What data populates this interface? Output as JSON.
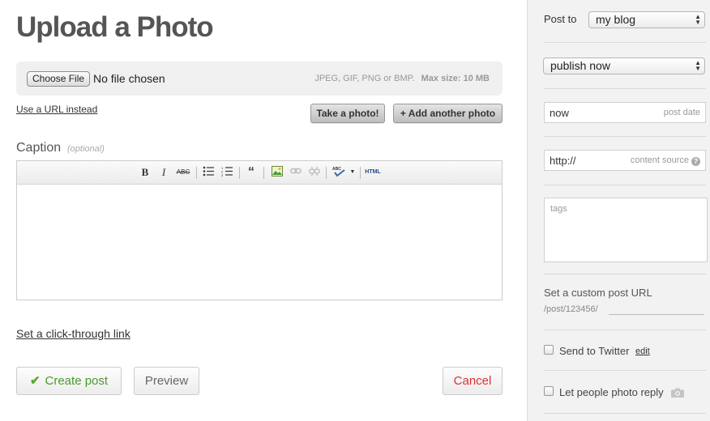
{
  "main": {
    "title": "Upload a Photo",
    "file": {
      "choose_label": "Choose File",
      "status": "No file chosen",
      "formats": "JPEG, GIF, PNG or BMP.",
      "max_size": "Max size: 10 MB"
    },
    "url_link": "Use a URL instead",
    "take_photo_label": "Take a photo!",
    "add_photo_label": "+ Add another photo",
    "caption": {
      "label": "Caption",
      "optional": "(optional)"
    },
    "toolbar": {
      "bold": "B",
      "italic": "I",
      "strike": "ABC",
      "html": "HTML",
      "spell": "ABC"
    },
    "clickthrough_link": "Set a click-through link",
    "actions": {
      "create": "Create post",
      "preview": "Preview",
      "cancel": "Cancel"
    }
  },
  "sidebar": {
    "post_to_label": "Post to",
    "post_to_value": "my blog",
    "publish_value": "publish now",
    "post_date": {
      "value": "now",
      "placeholder": "post date"
    },
    "content_source": {
      "value": "http://",
      "placeholder": "content source"
    },
    "tags_placeholder": "tags",
    "custom_url": {
      "label": "Set a custom post URL",
      "path": "/post/123456/"
    },
    "twitter": {
      "label": "Send to Twitter",
      "edit": "edit"
    },
    "photo_reply": {
      "label": "Let people photo reply"
    }
  },
  "colors": {
    "accent_green": "#4b9a2b",
    "cancel_red": "#d33333",
    "sidebar_bg": "#f2f2f2"
  }
}
